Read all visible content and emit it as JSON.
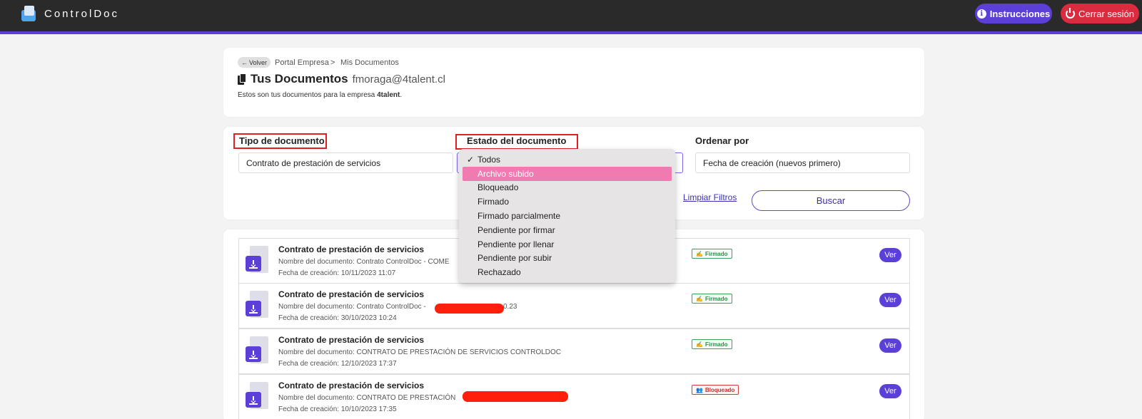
{
  "app": {
    "name": "ControlDoc"
  },
  "header": {
    "instructions_label": "Instrucciones",
    "logout_label": "Cerrar sesión",
    "colors": {
      "bar": "#2b2a2b",
      "accent": "#5b3fd6",
      "danger": "#d92d3f"
    }
  },
  "breadcrumb": {
    "back_label": "Volver",
    "portal": "Portal Empresa",
    "separator": ">",
    "current": "Mis Documentos"
  },
  "page": {
    "title": "Tus Documentos",
    "email": "fmoraga@4talent.cl",
    "subtitle_prefix": "Estos son tus documentos para la empresa ",
    "company": "4talent",
    "subtitle_suffix": "."
  },
  "filters": {
    "tipo_label": "Tipo de documento",
    "tipo_value": "Contrato de prestación de servicios",
    "estado_label": "Estado del documento",
    "orden_label": "Ordenar por",
    "orden_value": "Fecha de creación (nuevos primero)",
    "clear_label": "Limpiar Filtros",
    "search_label": "Buscar"
  },
  "estado_dropdown": {
    "check_icon": "checkmark",
    "options": [
      "Todos",
      "Archivo subido",
      "Bloqueado",
      "Firmado",
      "Firmado parcialmente",
      "Pendiente por firmar",
      "Pendiente por llenar",
      "Pendiente por subir",
      "Rechazado"
    ],
    "checked": "Todos",
    "highlighted": "Archivo subido"
  },
  "documents": [
    {
      "title": "Contrato de prestación de servicios",
      "name": "Nombre del documento: Contrato ControlDoc - COME",
      "name_tail": "",
      "date": "Fecha de creación: 10/11/2023 11:07",
      "status": "Firmado",
      "status_icon": "signature-icon",
      "view_label": "Ver"
    },
    {
      "title": "Contrato de prestación de servicios",
      "name": "Nombre del documento: Contrato ControlDoc -",
      "name_tail": "0.23",
      "date": "Fecha de creación: 30/10/2023 10:24",
      "status": "Firmado",
      "status_icon": "signature-icon",
      "view_label": "Ver"
    },
    {
      "title": "Contrato de prestación de servicios",
      "name": "Nombre del documento: CONTRATO DE PRESTACIÓN DE SERVICIOS CONTROLDOC",
      "name_tail": "",
      "date": "Fecha de creación: 12/10/2023 17:37",
      "status": "Firmado",
      "status_icon": "signature-icon",
      "view_label": "Ver"
    },
    {
      "title": "Contrato de prestación de servicios",
      "name": "Nombre del documento: CONTRATO DE PRESTACIÓN",
      "name_tail": "",
      "date": "Fecha de creación: 10/10/2023 17:35",
      "status": "Bloqueado",
      "status_icon": "users-lock-icon",
      "view_label": "Ver"
    }
  ]
}
